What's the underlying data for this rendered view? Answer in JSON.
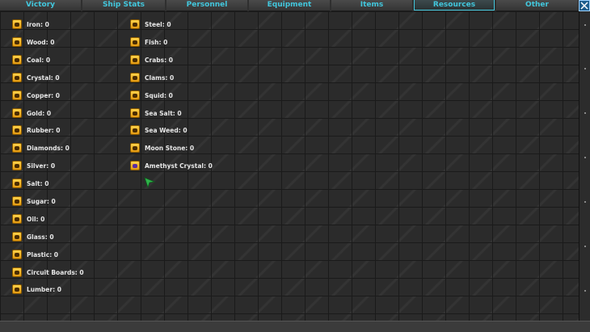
{
  "tabs": [
    {
      "label": "Victory",
      "active": false
    },
    {
      "label": "Ship Stats",
      "active": false
    },
    {
      "label": "Personnel",
      "active": false
    },
    {
      "label": "Equipment",
      "active": false
    },
    {
      "label": "Items",
      "active": false
    },
    {
      "label": "Resources",
      "active": true
    },
    {
      "label": "Other",
      "active": false
    }
  ],
  "resources_col1": [
    {
      "label": "Iron: 0",
      "icon": "iron-icon"
    },
    {
      "label": "Wood: 0",
      "icon": "wood-icon"
    },
    {
      "label": "Coal: 0",
      "icon": "coal-icon"
    },
    {
      "label": "Crystal: 0",
      "icon": "crystal-icon"
    },
    {
      "label": "Copper: 0",
      "icon": "copper-icon"
    },
    {
      "label": "Gold: 0",
      "icon": "gold-icon"
    },
    {
      "label": "Rubber: 0",
      "icon": "rubber-icon"
    },
    {
      "label": "Diamonds: 0",
      "icon": "diamond-icon"
    },
    {
      "label": "Silver: 0",
      "icon": "silver-icon"
    },
    {
      "label": "Salt: 0",
      "icon": "salt-icon"
    },
    {
      "label": "Sugar: 0",
      "icon": "sugar-icon"
    },
    {
      "label": "Oil: 0",
      "icon": "oil-icon"
    },
    {
      "label": "Glass: 0",
      "icon": "glass-icon"
    },
    {
      "label": "Plastic: 0",
      "icon": "plastic-icon"
    },
    {
      "label": "Circuit Boards: 0",
      "icon": "circuit-board-icon"
    },
    {
      "label": "Lumber: 0",
      "icon": "lumber-icon"
    }
  ],
  "resources_col2": [
    {
      "label": "Steel: 0",
      "icon": "steel-icon"
    },
    {
      "label": "Fish: 0",
      "icon": "fish-icon"
    },
    {
      "label": "Crabs: 0",
      "icon": "crab-icon"
    },
    {
      "label": "Clams: 0",
      "icon": "clam-icon"
    },
    {
      "label": "Squid: 0",
      "icon": "squid-icon"
    },
    {
      "label": "Sea Salt: 0",
      "icon": "sea-salt-icon"
    },
    {
      "label": "Sea Weed: 0",
      "icon": "sea-weed-icon"
    },
    {
      "label": "Moon Stone: 0",
      "icon": "moon-stone-icon"
    },
    {
      "label": "Amethyst Crystal: 0",
      "icon": "amethyst-crystal-icon"
    }
  ],
  "colors": {
    "tab_text": "#42c7dd",
    "item_text": "#e8e8e8",
    "icon_fill": "#f3b323",
    "cursor": "#2fb34a"
  }
}
